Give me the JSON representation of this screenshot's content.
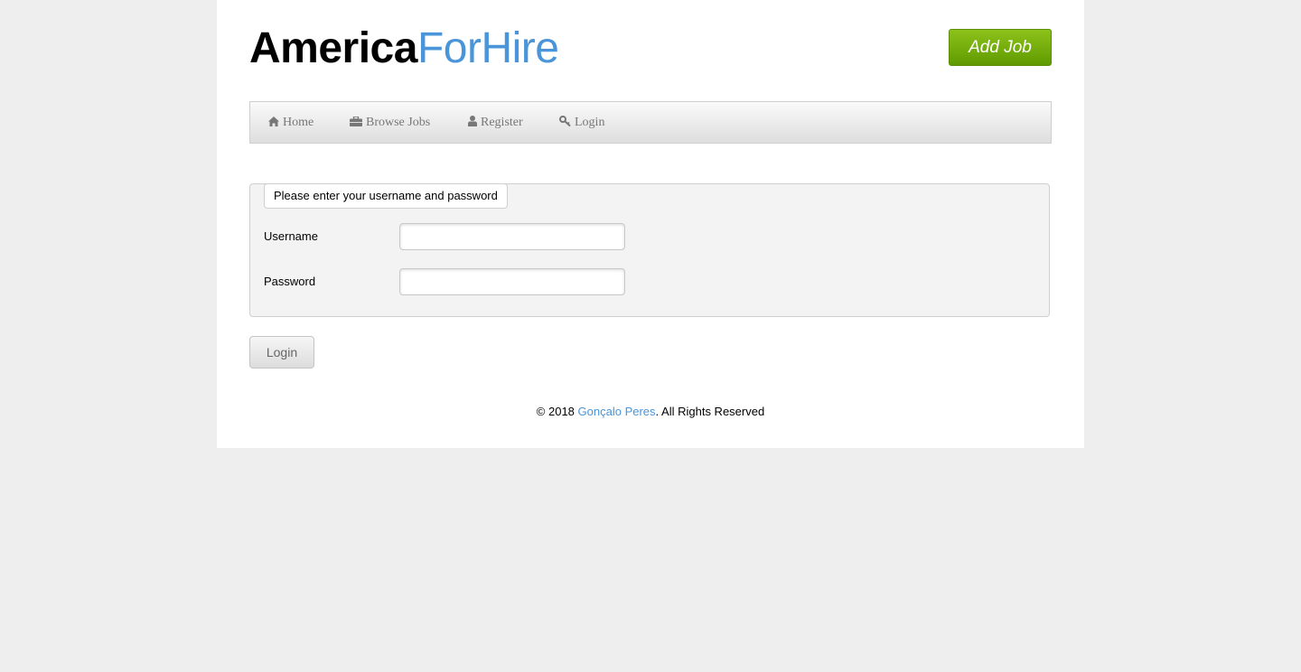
{
  "header": {
    "logo_part1": "America",
    "logo_part2": "ForHire",
    "add_job_label": "Add Job"
  },
  "nav": {
    "items": [
      {
        "label": "Home",
        "icon": "home-icon"
      },
      {
        "label": "Browse Jobs",
        "icon": "briefcase-icon"
      },
      {
        "label": "Register",
        "icon": "user-icon"
      },
      {
        "label": "Login",
        "icon": "key-icon"
      }
    ]
  },
  "login_form": {
    "legend": "Please enter your username and password",
    "username_label": "Username",
    "username_value": "",
    "password_label": "Password",
    "password_value": "",
    "submit_label": "Login"
  },
  "footer": {
    "prefix": "© 2018 ",
    "author": "Gonçalo Peres",
    "suffix": ". All Rights Reserved"
  },
  "colors": {
    "background": "#eeeeee",
    "logo_accent": "#4a95d9",
    "add_job_green": "#6fa70a",
    "nav_text": "#777777"
  }
}
